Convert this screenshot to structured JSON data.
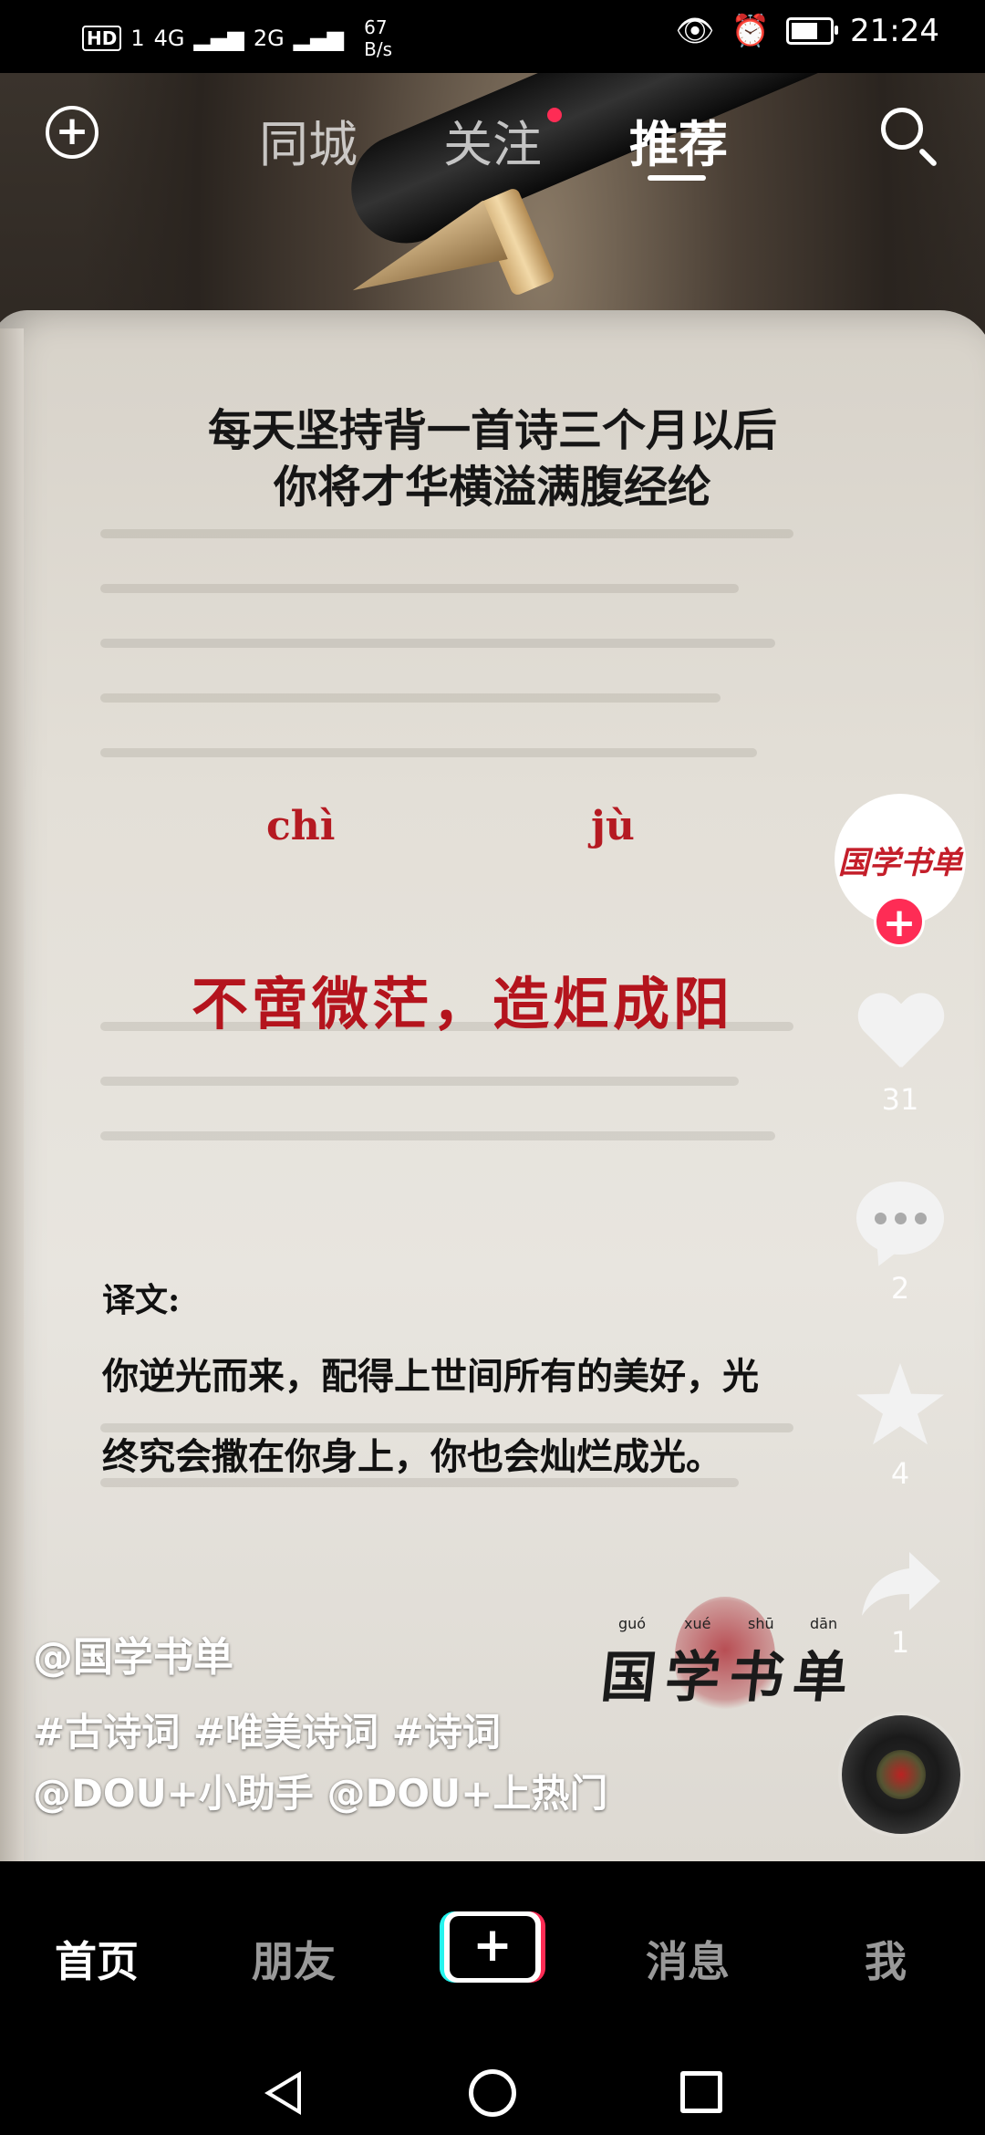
{
  "status_bar": {
    "hd": "HD",
    "sim": "1",
    "signal1": "4G",
    "signal2": "2G",
    "speed_value": "67",
    "speed_unit": "B/s",
    "time": "21:24"
  },
  "top_nav": {
    "tabs": [
      "同城",
      "关注",
      "推荐"
    ],
    "active_tab": "推荐"
  },
  "video": {
    "headline_line1": "每天坚持背一首诗三个月以后",
    "headline_line2": "你将才华横溢满腹经纶",
    "pinyin_1": "chì",
    "pinyin_2": "jù",
    "idiom": "不啻微茫，造炬成阳",
    "translation_label": "译文:",
    "translation_line1": "你逆光而来，配得上世间所有的美好，光",
    "translation_line2": "终究会撒在你身上，你也会灿烂成光。",
    "seal_text": "国学书单",
    "seal_pinyin": [
      "guó",
      "xué",
      "shū",
      "dān"
    ]
  },
  "actions": {
    "avatar_text": "国学书单",
    "likes": "31",
    "comments": "2",
    "favorites": "4",
    "shares": "1"
  },
  "caption": {
    "author": "@国学书单",
    "hashtags": "#古诗词 #唯美诗词 #诗词",
    "mentions": "@DOU+小助手 @DOU+上热门"
  },
  "bottom_nav": {
    "items": [
      "首页",
      "朋友",
      "消息",
      "我"
    ],
    "create_symbol": "+"
  },
  "colors": {
    "accent_red": "#fe2c55",
    "accent_cyan": "#25f4ee",
    "idiom_red": "#b4141d"
  }
}
